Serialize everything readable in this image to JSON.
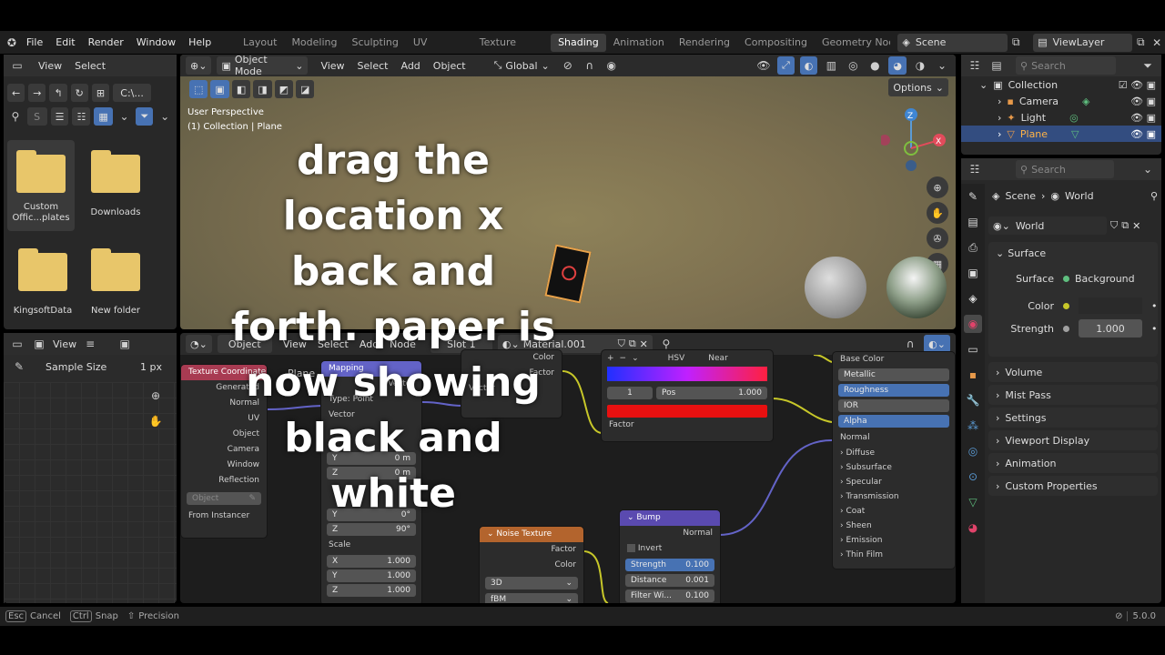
{
  "menu": {
    "file": "File",
    "edit": "Edit",
    "render": "Render",
    "window": "Window",
    "help": "Help"
  },
  "workspaces": [
    "Layout",
    "Modeling",
    "Sculpting",
    "UV Editing",
    "Texture Paint",
    "Shading",
    "Animation",
    "Rendering",
    "Compositing",
    "Geometry Nodes"
  ],
  "scene": "Scene",
  "view_layer": "ViewLayer",
  "file_browser": {
    "view": "View",
    "select": "Select",
    "path": "C:\\...",
    "search_placeholder": "S",
    "folders": [
      "Custom Offic...plates",
      "Downloads",
      "KingsoftData",
      "New folder"
    ]
  },
  "image_editor": {
    "view": "View",
    "sample_size_label": "Sample Size",
    "sample_size_value": "1 px"
  },
  "viewport": {
    "mode": "Object Mode",
    "view": "View",
    "select": "Select",
    "add": "Add",
    "object": "Object",
    "transform": "Global",
    "options": "Options",
    "info_line1": "User Perspective",
    "info_line2": "(1) Collection | Plane"
  },
  "node_editor": {
    "object": "Object",
    "view": "View",
    "select": "Select",
    "add": "Add",
    "node": "Node",
    "slot": "Slot 1",
    "material": "Material.001",
    "plane_label": "Plane",
    "tex_coord": {
      "title": "Texture Coordinate",
      "outputs": [
        "Generated",
        "Normal",
        "UV",
        "Object",
        "Camera",
        "Window",
        "Reflection"
      ],
      "object_field": "Object",
      "from_instancer": "From Instancer"
    },
    "mapping": {
      "title": "Mapping",
      "vector_out": "Vector",
      "type_label": "Type:",
      "type_value": "Point",
      "vector_in": "Vector",
      "loc_y": "0 m",
      "loc_z": "0 m",
      "rot_y": "0°",
      "rot_z": "90°",
      "scale": "Scale",
      "scale_x": "1.000",
      "scale_y": "1.000",
      "scale_z": "1.000",
      "axis_x": "X",
      "axis_y": "Y",
      "axis_z": "Z"
    },
    "math_node": {
      "color": "Color",
      "factor": "Factor",
      "vector": "Vector"
    },
    "color_ramp": {
      "mode": "HSV",
      "interp": "Near",
      "index": "1",
      "pos_label": "Pos",
      "pos_value": "1.000",
      "factor": "Factor"
    },
    "bsdf": {
      "base_color": "Base Color",
      "metallic": "Metallic",
      "roughness": "Roughness",
      "ior": "IOR",
      "alpha": "Alpha",
      "normal": "Normal",
      "sections": [
        "Diffuse",
        "Subsurface",
        "Specular",
        "Transmission",
        "Coat",
        "Sheen",
        "Emission",
        "Thin Film"
      ]
    },
    "noise": {
      "title": "Noise Texture",
      "factor": "Factor",
      "color": "Color",
      "dims": "3D",
      "type": "fBM"
    },
    "bump": {
      "title": "Bump",
      "normal": "Normal",
      "invert": "Invert",
      "strength_label": "Strength",
      "strength_value": "0.100",
      "distance_label": "Distance",
      "distance_value": "0.001",
      "filter_label": "Filter Wi...",
      "filter_value": "0.100"
    }
  },
  "outliner": {
    "search_placeholder": "Search",
    "collection": "Collection",
    "items": [
      "Camera",
      "Light",
      "Plane"
    ]
  },
  "properties": {
    "search_placeholder": "Search",
    "breadcrumb_scene": "Scene",
    "breadcrumb_world": "World",
    "world_name": "World",
    "surface_panel": "Surface",
    "surface_label": "Surface",
    "surface_value": "Background",
    "color_label": "Color",
    "strength_label": "Strength",
    "strength_value": "1.000",
    "panels": [
      "Volume",
      "Mist Pass",
      "Settings",
      "Viewport Display",
      "Animation",
      "Custom Properties"
    ]
  },
  "statusbar": {
    "esc": "Esc",
    "cancel": "Cancel",
    "ctrl": "Ctrl",
    "snap": "Snap",
    "precision": "Precision",
    "version": "5.0.0"
  },
  "caption": [
    "drag the",
    "location x",
    "back and",
    "forth. paper is",
    "now showing",
    "black and",
    "white"
  ],
  "colors": {
    "accent": "#4772b3",
    "selected_row": "#334d80",
    "folder": "#e8c66a"
  }
}
